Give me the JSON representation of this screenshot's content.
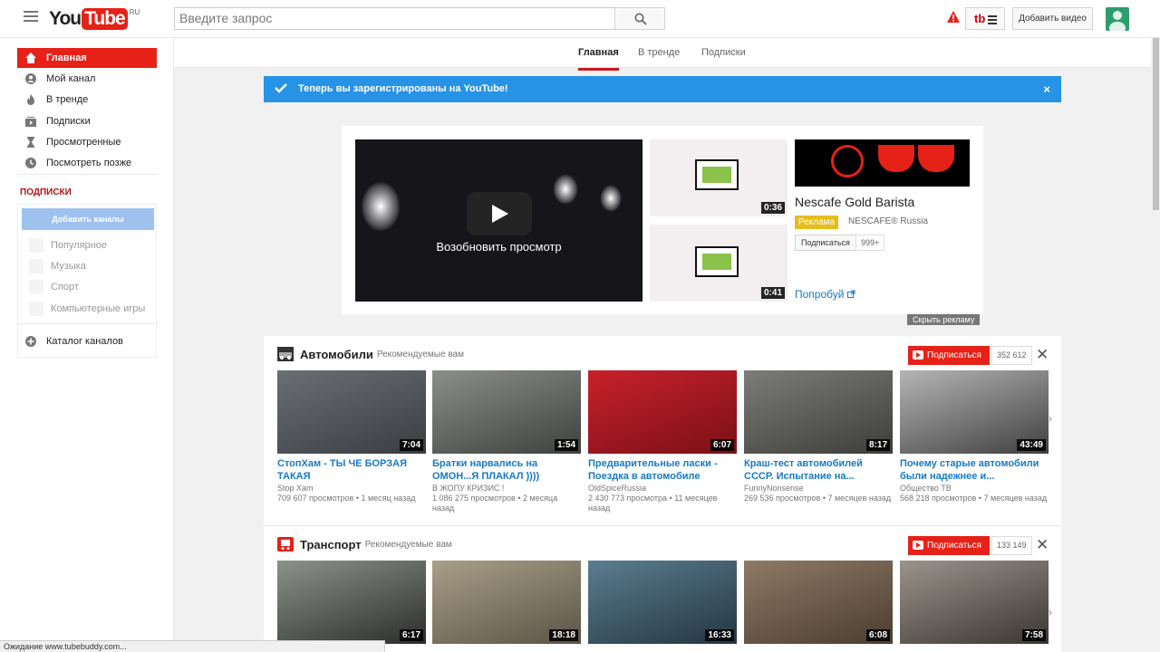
{
  "masthead": {
    "logo_you": "You",
    "logo_tube": "Tube",
    "logo_region": "RU",
    "search_placeholder": "Введите запрос",
    "tb_label": "tb",
    "upload_label": "Добавить видео"
  },
  "sidebar": {
    "items": [
      {
        "label": "Главная",
        "icon": "home-icon"
      },
      {
        "label": "Мой канал",
        "icon": "user-icon"
      },
      {
        "label": "В тренде",
        "icon": "flame-icon"
      },
      {
        "label": "Подписки",
        "icon": "subscriptions-icon"
      },
      {
        "label": "Просмотренные",
        "icon": "hourglass-icon"
      },
      {
        "label": "Посмотреть позже",
        "icon": "clock-icon"
      }
    ],
    "subs_heading": "ПОДПИСКИ",
    "add_channels": "Добавить каналы",
    "suggested": [
      "Популярное",
      "Музыка",
      "Спорт",
      "Компьютерные игры"
    ],
    "catalog": "Каталог каналов"
  },
  "tabs": [
    "Главная",
    "В тренде",
    "Подписки"
  ],
  "alert": {
    "message": "Теперь вы зарегистрированы на YouTube!",
    "close": "×"
  },
  "ad": {
    "resume": "Возобновить просмотр",
    "thumb_durations": [
      "0:36",
      "0:41"
    ],
    "title": "Nescafe Gold Barista",
    "badge": "Реклама",
    "channel": "NESCAFE® Russia",
    "subscribe": "Подписаться",
    "subscribers": "999+",
    "link": "Попробуй",
    "hide": "Скрыть рекламу"
  },
  "shelves": [
    {
      "title": "Автомобили",
      "rec": "Рекомендуемые вам",
      "subscribe": "Подписаться",
      "count": "352 612",
      "videos": [
        {
          "title": "СтопХам - ТЫ ЧЕ БОРЗАЯ ТАКАЯ",
          "channel": "Stop Xam",
          "meta": "709 607 просмотров • 1 месяц назад",
          "duration": "7:04",
          "colors": [
            "#6b6f74",
            "#3a3d40"
          ]
        },
        {
          "title": "Братки нарвались на ОМОН...Я ПЛАКАЛ ))))",
          "channel": "В ЖОПУ КРИЗИС !",
          "meta": "1 086 275 просмотров • 2 месяца назад",
          "duration": "1:54",
          "colors": [
            "#8a8f8a",
            "#3e423f"
          ]
        },
        {
          "title": "Предварительные ласки - Поездка в автомобиле",
          "channel": "OldSpiceRussia",
          "meta": "2 430 773 просмотра • 11 месяцев назад",
          "duration": "6:07",
          "colors": [
            "#c8212b",
            "#7a1016"
          ]
        },
        {
          "title": "Краш-тест автомобилей СССР. Испытание на...",
          "channel": "FunnyNonsense",
          "meta": "269 536 просмотров • 7 месяцев назад",
          "duration": "8:17",
          "colors": [
            "#7c7c78",
            "#3d3d3a"
          ]
        },
        {
          "title": "Почему старые автомобили были надежнее и...",
          "channel": "Общество ТВ",
          "meta": "568 218 просмотров • 7 месяцев назад",
          "duration": "43:49",
          "colors": [
            "#b5b5b5",
            "#404040"
          ]
        }
      ]
    },
    {
      "title": "Транспорт",
      "rec": "Рекомендуемые вам",
      "subscribe": "Подписаться",
      "count": "133 149",
      "videos": [
        {
          "title": "",
          "channel": "",
          "meta": "",
          "duration": "6:17",
          "colors": [
            "#8d928c",
            "#2b2d2b"
          ]
        },
        {
          "title": "",
          "channel": "",
          "meta": "",
          "duration": "18:18",
          "colors": [
            "#a99e88",
            "#5b5446"
          ]
        },
        {
          "title": "",
          "channel": "",
          "meta": "",
          "duration": "16:33",
          "colors": [
            "#5b7d90",
            "#243641"
          ]
        },
        {
          "title": "",
          "channel": "",
          "meta": "",
          "duration": "6:08",
          "colors": [
            "#8e7a66",
            "#4b3d30"
          ]
        },
        {
          "title": "",
          "channel": "",
          "meta": "",
          "duration": "7:58",
          "colors": [
            "#9a948b",
            "#3a3631"
          ]
        }
      ]
    }
  ],
  "status_text": "Ожидание www.tubebuddy.com...",
  "colors": {
    "brand": "#e62117",
    "alert": "#2793e6",
    "link": "#167ac6"
  }
}
